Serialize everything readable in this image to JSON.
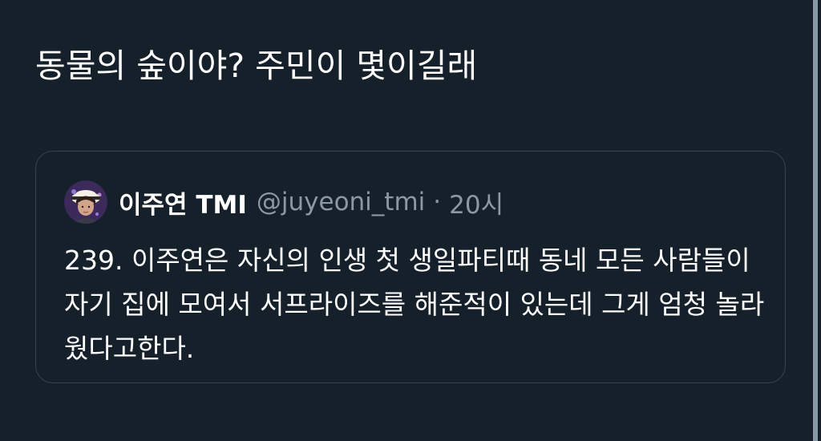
{
  "tweet": {
    "text": "동물의 숲이야? 주민이 몇이길래"
  },
  "quote": {
    "author_name": "이주연 TMI",
    "author_handle": "@juyeoni_tmi",
    "separator": "·",
    "timestamp": "20시",
    "body": "239. 이주연은 자신의 인생 첫 생일파티때 동네 모든 사람들이 자기 집에 모여서 서프라이즈를 해준적이 있는데 그게 엄청 놀라웠다고한다."
  },
  "colors": {
    "background": "#15202b",
    "text": "#ffffff",
    "secondary_text": "#8b98a5",
    "border": "#38444d"
  },
  "icons": {
    "avatar": "profile-photo"
  }
}
